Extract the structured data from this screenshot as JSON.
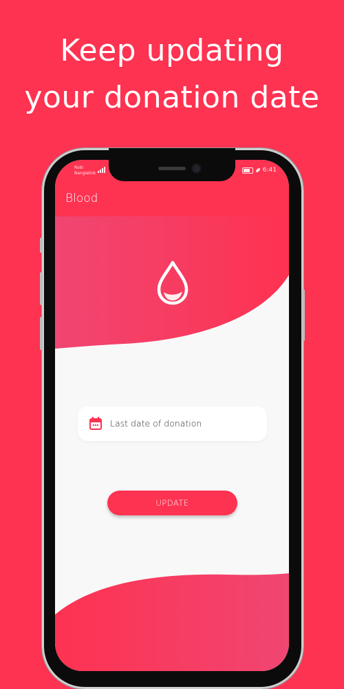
{
  "promo": {
    "headline_line1": "Keep updating",
    "headline_line2": "your donation date"
  },
  "status_bar": {
    "carrier_line1": "Robi",
    "carrier_line2": "Banglalink",
    "time": "6:41"
  },
  "app_bar": {
    "title": "Blood"
  },
  "hero": {
    "icon": "blood-drop-icon"
  },
  "form": {
    "date_field": {
      "icon": "calendar-icon",
      "label": "Last date of donation"
    },
    "update_label": "UPDATE"
  },
  "colors": {
    "accent": "#fe3251",
    "gradient_start": "#f2506f",
    "screen_background": "#f8f8f8",
    "field_background": "#ffffff"
  }
}
